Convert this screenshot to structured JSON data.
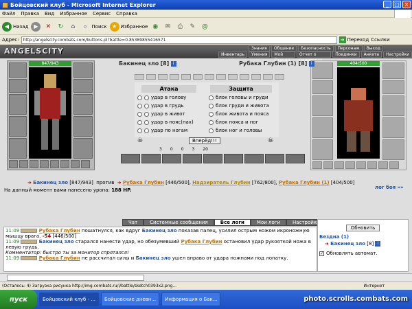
{
  "window": {
    "title": "Бойцовский клуб - Microsoft Internet Explorer"
  },
  "menu": [
    "Файл",
    "Правка",
    "Вид",
    "Избранное",
    "Сервис",
    "Справка"
  ],
  "toolbar": {
    "back": "Назад",
    "search": "Поиск",
    "favorites": "Избранное"
  },
  "address": {
    "label": "Адрес:",
    "url": "http://angelscity.combats.com/buttons.pl?battle=0.85389855416571",
    "go": "Переход",
    "links": "Ссылки"
  },
  "game": {
    "logo": "ANGELSCITY",
    "nav_top": [
      "Знания",
      "Общение",
      "Безопасность",
      "Персонаж",
      "Выход"
    ],
    "nav_bottom": [
      "Инвентарь",
      "Умения",
      "Мой Скролл",
      "Отчет о переводах",
      "Поединки",
      "Анкета",
      "Настройки"
    ],
    "left_fighter": {
      "name": "Бакинец зло",
      "level": "[8]",
      "hp": "847/943",
      "hp_fraction": 0.9
    },
    "right_fighter": {
      "name": "Рубака Глубин",
      "level": "(1) [8]",
      "hp": "404/500",
      "hp_fraction": 0.81
    },
    "attack_header": "Атака",
    "defense_header": "Защита",
    "attacks": [
      "удар в голову",
      "удар в грудь",
      "удар в живот",
      "удар в пояс(пах)",
      "удар по ногам"
    ],
    "defenses": [
      "блок головы и груди",
      "блок груди и живота",
      "блок живота и пояса",
      "блок пояса и ног",
      "блок ног и головы"
    ],
    "go_button": "Вперёд!!!",
    "counters": [
      "3",
      "0",
      "0",
      "3",
      "20"
    ],
    "vs_line": {
      "left": "Бакинец зло",
      "left_hp": "[847/943]",
      "versus": "против",
      "right1": "Рубака Глубин",
      "right1_hp": "[446/500]",
      "right2": "Надзиратель Глубин",
      "right2_hp": "[762/800]",
      "right3": "Рубака Глубин (1)",
      "right3_hp": "[404/500]"
    },
    "damage_text": "На данный момент вами нанесено урона:",
    "damage_value": "188 HP.",
    "battle_log_link": "лог боя »»"
  },
  "tabs": [
    "Чат",
    "Системные сообщения",
    "Все логи",
    "Мои логи",
    "Настройки"
  ],
  "active_tab": "Все логи",
  "chat_lines": [
    {
      "time": "11:09",
      "name": "Рубака Глубин",
      "text": "пошатнулся, как вдруг",
      "name2": "Бакинец зло",
      "text2": "показав палец, усилил острым ножом",
      "cont": "икроножную мышцу врага.",
      "dmg": "-54",
      "hp": "[446/500]"
    },
    {
      "time": "11:09",
      "name": "Бакинец зло",
      "text": "старался нанести удар, но обезумевший",
      "name2": "Рубака Глубин",
      "text2": "остановил удар",
      "cont": "рукояткой ножа в левую грудь."
    },
    {
      "comment": "Комментатор: быстро ты за монитор спрятался!"
    },
    {
      "time": "11:09",
      "name": "Рубака Глубин",
      "text": "не рассчитал силы и",
      "name2": "Бакинец зло",
      "text2": "ушел вправо от удара ножнами под",
      "cont": "лопатку."
    }
  ],
  "right_panel": {
    "refresh": "Обновить",
    "location": "Бездна (1)",
    "player": "Бакинец зло",
    "level": "[8]",
    "auto": "Обновлять автомат."
  },
  "status": {
    "text": "(Осталось: 4) Загрузка рисунка http://img.combats.ru/i/battle/sketch0393x2.png...",
    "zone": "Интернет"
  },
  "taskbar": {
    "start": "пуск",
    "tasks": [
      "Бойцовский клуб - ...",
      "Бойцовские дневн...",
      "Информация о Бак..."
    ]
  },
  "watermark": "photo.scrolls.combats.com"
}
